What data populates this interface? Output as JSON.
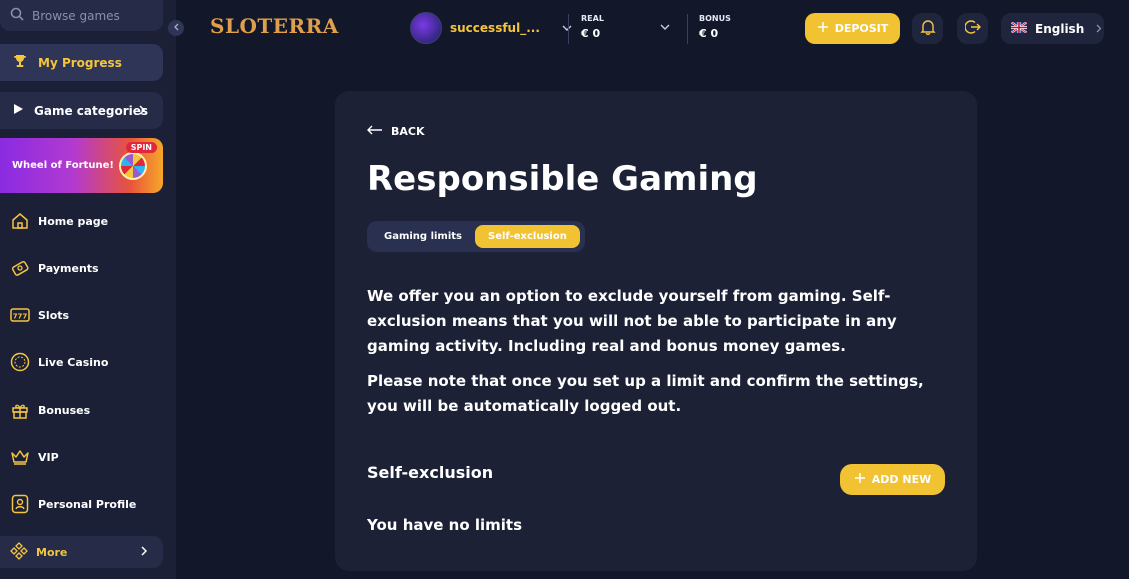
{
  "sidebar": {
    "search_placeholder": "Browse games",
    "my_progress": "My Progress",
    "game_categories": "Game categories",
    "promo": {
      "label": "Wheel of Fortune!",
      "badge": "SPIN"
    },
    "items": [
      {
        "label": "Home page",
        "icon": "home-icon"
      },
      {
        "label": "Payments",
        "icon": "payments-icon"
      },
      {
        "label": "Slots",
        "icon": "slots-icon"
      },
      {
        "label": "Live Casino",
        "icon": "live-casino-icon"
      },
      {
        "label": "Bonuses",
        "icon": "gift-icon"
      },
      {
        "label": "VIP",
        "icon": "crown-icon"
      },
      {
        "label": "Personal Profile",
        "icon": "profile-icon"
      }
    ],
    "more": "More"
  },
  "header": {
    "logo": "SLOTERRA",
    "username": "successful_...",
    "real": {
      "label": "REAL",
      "value": "€ 0"
    },
    "bonus": {
      "label": "BONUS",
      "value": "€ 0"
    },
    "deposit": "DEPOSIT",
    "language": "English"
  },
  "main": {
    "back": "BACK",
    "title": "Responsible Gaming",
    "tabs": [
      {
        "label": "Gaming limits",
        "active": false
      },
      {
        "label": "Self-exclusion",
        "active": true
      }
    ],
    "paragraph1": "We offer you an option to exclude yourself from gaming. Self-exclusion means that you will not be able to participate in any gaming activity. Including real and bonus money games.",
    "paragraph2": "Please note that once you set up a limit and confirm the settings, you will be automatically logged out.",
    "section_title": "Self-exclusion",
    "add_new": "ADD NEW",
    "empty_state": "You have no limits"
  },
  "colors": {
    "accent": "#f1c232",
    "background": "#13172a",
    "card": "#1c2136",
    "sidebar": "#1b2036"
  }
}
